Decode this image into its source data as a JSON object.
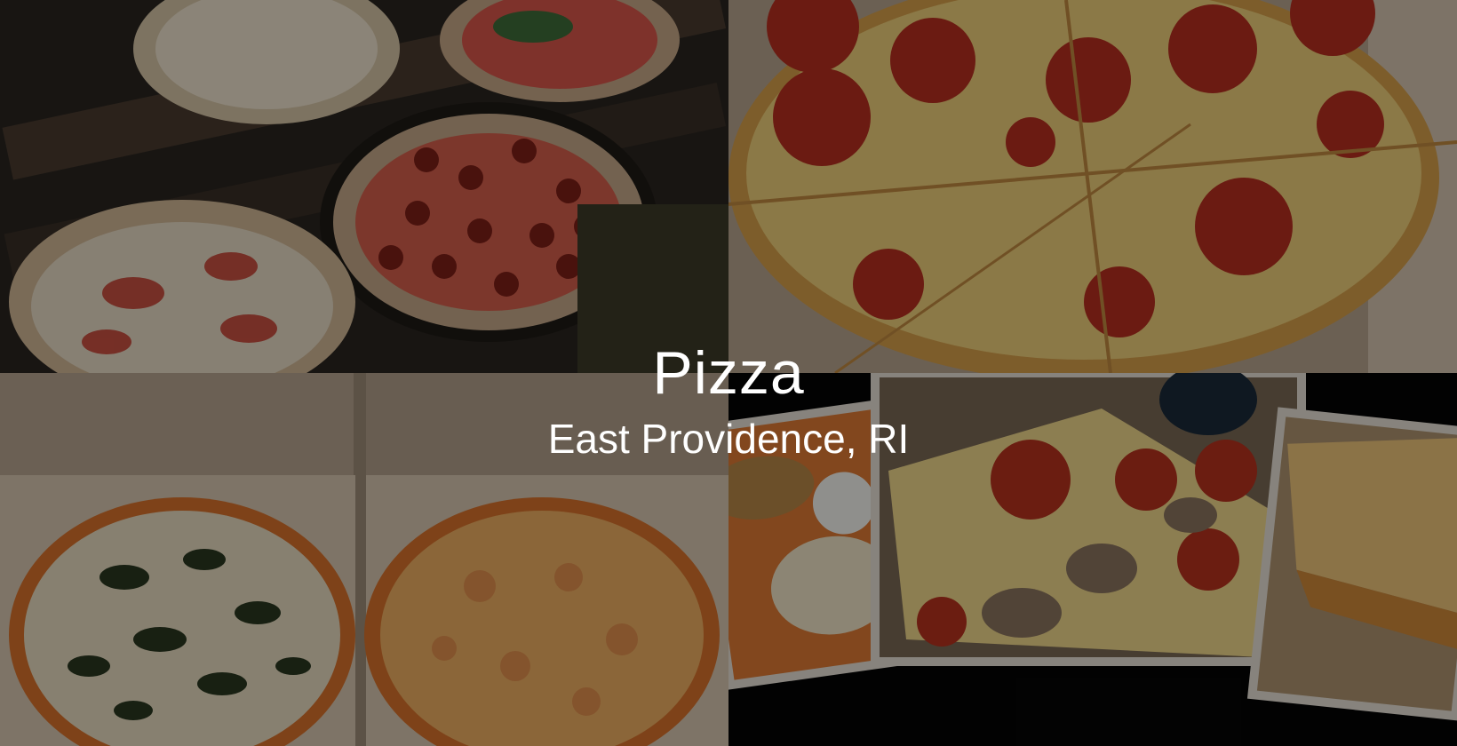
{
  "hero": {
    "title": "Pizza",
    "subtitle": "East Providence, RI"
  },
  "colors": {
    "text": "#ffffff",
    "overlay": "#000000"
  }
}
